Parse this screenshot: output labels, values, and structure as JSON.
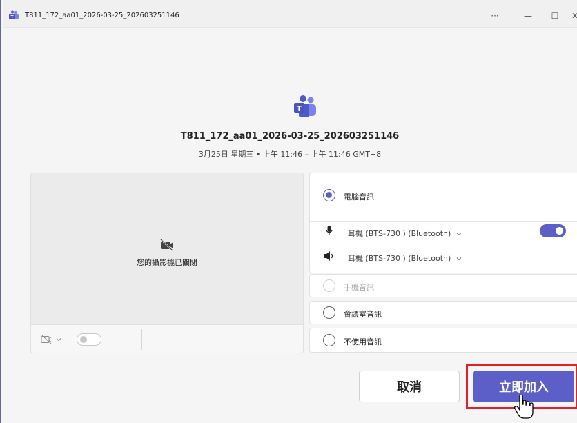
{
  "window": {
    "title": "T811_172_aa01_2026-03-25_202603251146",
    "more_label": "···",
    "minimize_label": "—",
    "maximize_label": "☐",
    "close_label": "✕"
  },
  "meeting": {
    "title": "T811_172_aa01_2026-03-25_202603251146",
    "time": "3月25日 星期三 • 上午 11:46 – 上午 11:46 GMT+8"
  },
  "video": {
    "camera_off_text": "您的攝影機已關閉",
    "camera_toggle_on": false
  },
  "audio": {
    "options": [
      {
        "label": "電腦音訊",
        "selected": true,
        "disabled": false
      },
      {
        "label": "手機音訊",
        "selected": false,
        "disabled": true
      },
      {
        "label": "會議室音訊",
        "selected": false,
        "disabled": false
      },
      {
        "label": "不使用音訊",
        "selected": false,
        "disabled": false
      }
    ],
    "microphone": "耳機 (BTS-730 ) (Bluetooth)",
    "speaker": "耳機 (BTS-730 ) (Bluetooth)",
    "mic_toggle_on": true
  },
  "actions": {
    "cancel_label": "取消",
    "join_label": "立即加入"
  },
  "colors": {
    "accent": "#5b5fc7",
    "highlight": "#e3202a"
  }
}
